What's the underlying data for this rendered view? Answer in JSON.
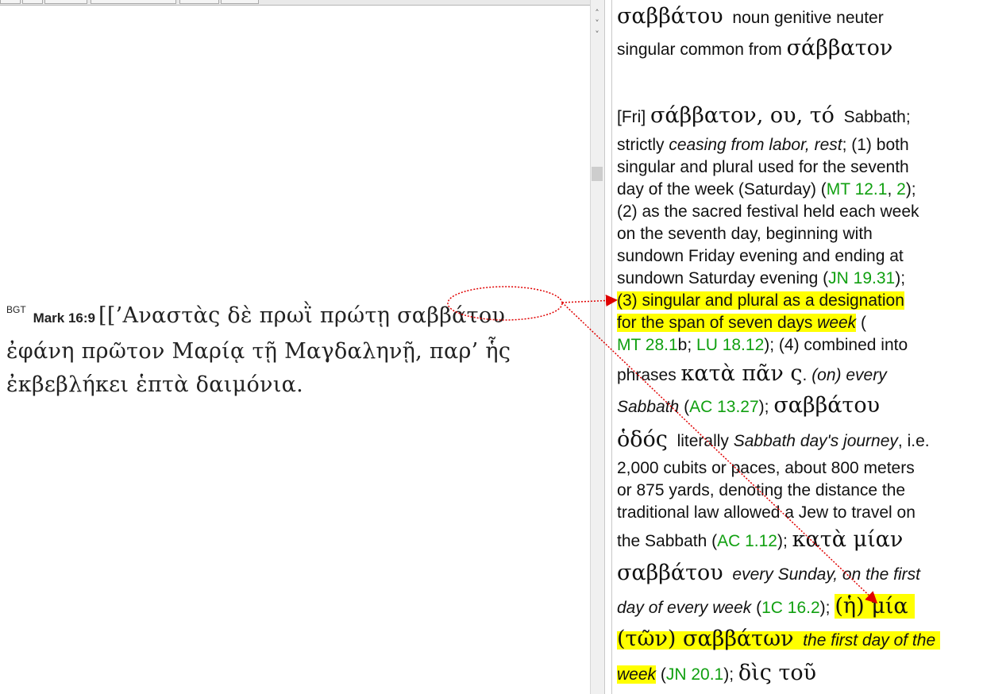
{
  "verse": {
    "source": "BGT",
    "reference": "Mark 16:9",
    "text_before": "[[’Αναστὰς δὲ πρωῒ πρώτῃ ",
    "target_word": "σαββάτου",
    "line2": "ἐφάνη πρῶτον Μαρίᾳ τῇ Μαγδαληνῇ, παρ’ ἧς",
    "line3": "ἐκβεβλήκει ἑπτὰ δαιμόνια."
  },
  "parse": {
    "word": "σαββάτου",
    "description": "noun genitive neuter",
    "line2": "singular common from",
    "lemma": "σάββατον"
  },
  "entry": {
    "l1_src": "[Fri]",
    "l1_head": "σάββατον",
    "l1_ou": "ου",
    "l1_to": "τό",
    "l1_gloss": "Sabbath;",
    "l2_a": "strictly ",
    "l2_i": "ceasing from labor, rest",
    "l2_b": "; (1) both",
    "l3": "singular and plural used for the seventh",
    "l4_a": "day of the week (Saturday) (",
    "l4_ref1": "MT 12.1",
    "l4_ref2": "2",
    "l4_b": ");",
    "l5": "(2) as the sacred festival held each week",
    "l6": "on the seventh day, beginning with",
    "l7": "sundown Friday evening and ending at",
    "l8_a": "sundown Saturday evening (",
    "l8_ref": "JN 19.31",
    "l8_b": ");",
    "l9": "(3) singular and plural as a designation",
    "l10_a": "for the span of seven days ",
    "l10_i": "week",
    "l10_b": " (",
    "l11_ref1": "MT 28.1",
    "l11_b": "b; ",
    "l11_ref2": "LU 18.12",
    "l11_c": "); (4) combined into",
    "l12_a": "phrases ",
    "l12_g": "κατὰ πᾶν ς",
    "l12_i": "(on) every",
    "l13_i": "Sabbath",
    "l13_ref": "AC 13.27",
    "l13_g": "σαββάτου",
    "l14_g": "ὁδός",
    "l14_a": "literally ",
    "l14_i": "Sabbath day's journey",
    "l14_b": ", i.e.",
    "l15": "2,000 cubits or paces, about 800 meters",
    "l16": "or 875 yards, denoting the distance the",
    "l17": "traditional law allowed a Jew to travel on",
    "l18_a": "the Sabbath (",
    "l18_ref": "AC 1.12",
    "l18_g": "κατὰ μίαν",
    "l19_g": "σαββάτου",
    "l19_i": "every Sunday, on the first",
    "l20_i": "day of every week",
    "l20_ref": "1C 16.2",
    "l20_g1": "ἡ",
    "l20_g2": "μία",
    "l21_g1": "τῶν",
    "l21_g2": "σαββάτων",
    "l21_i": "the first day of the",
    "l22_i": "week",
    "l22_ref": "JN 20.1",
    "l22_g": "δὶς τοῦ"
  },
  "colors": {
    "highlight": "#ffff00",
    "link": "#11a011",
    "annotation": "#e00000"
  },
  "icons": [
    "scroll-up-arrow-icon",
    "scroll-down-arrow-icon"
  ]
}
